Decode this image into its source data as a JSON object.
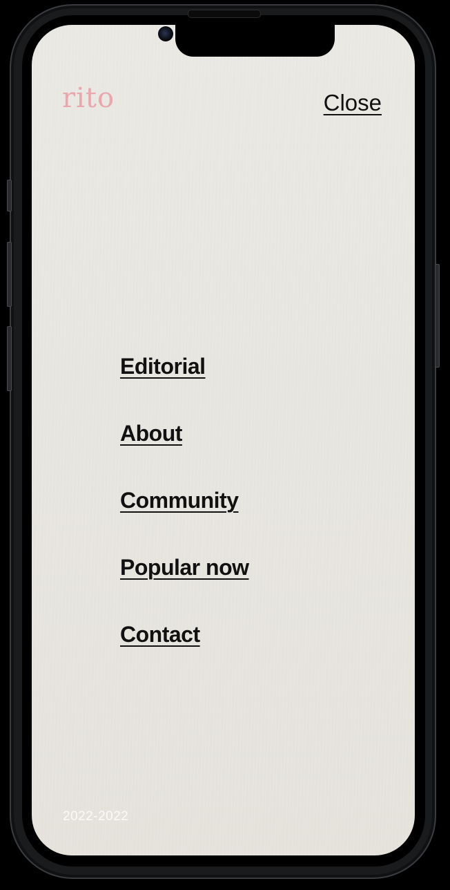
{
  "header": {
    "logo_text": "rito",
    "close_label": "Close"
  },
  "nav": {
    "items": [
      {
        "label": "Editorial"
      },
      {
        "label": "About"
      },
      {
        "label": "Community"
      },
      {
        "label": "Popular now"
      },
      {
        "label": "Contact"
      }
    ]
  },
  "footer": {
    "year_range": "2022-2022"
  },
  "colors": {
    "logo": "#e9a6ad",
    "text": "#111111",
    "background": "#e8e6e0",
    "footer_text": "#fbfaf7"
  }
}
